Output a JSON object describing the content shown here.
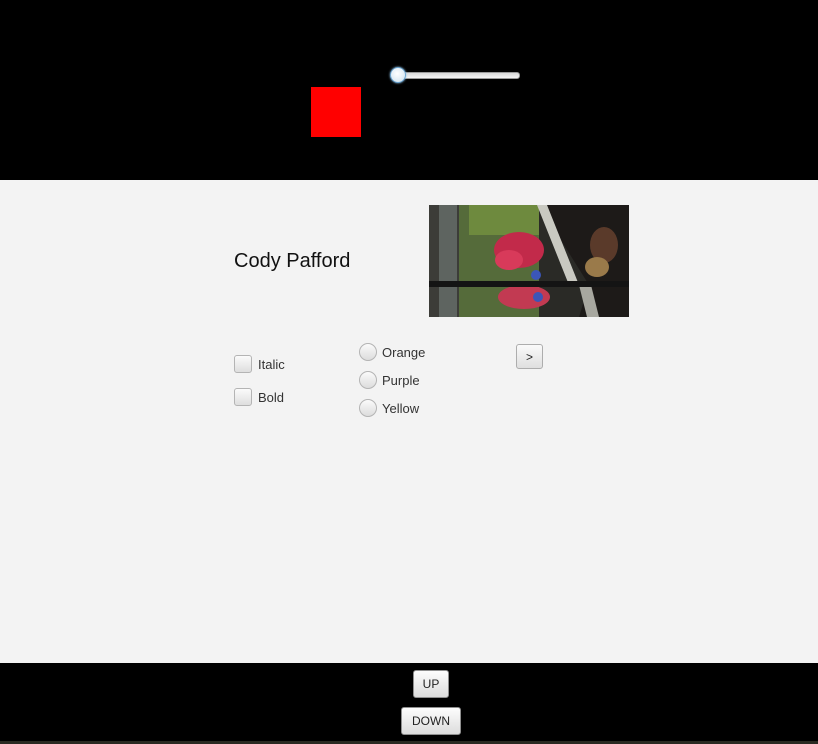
{
  "top": {
    "slider": {
      "value_fraction": 0.0
    },
    "shape": {
      "color": "#ff0000"
    }
  },
  "main": {
    "name": "Cody Pafford",
    "image": {
      "description_icon": "photo-image"
    },
    "checkboxes": [
      {
        "label": "Italic",
        "checked": false
      },
      {
        "label": "Bold",
        "checked": false
      }
    ],
    "radios": [
      {
        "label": "Orange",
        "selected": false
      },
      {
        "label": "Purple",
        "selected": false
      },
      {
        "label": "Yellow",
        "selected": false
      }
    ],
    "next_label": ">"
  },
  "bottom": {
    "up_label": "UP",
    "down_label": "DOWN"
  },
  "colors": {
    "bar_background": "#000000",
    "content_background": "#f3f3f3",
    "accent": "#6aa3cf"
  }
}
